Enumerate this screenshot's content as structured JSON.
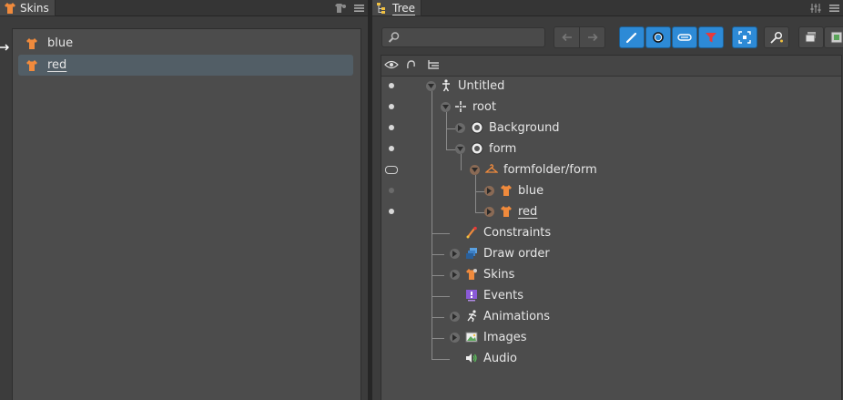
{
  "skins_panel": {
    "tab_label": "Skins",
    "items": [
      {
        "label": "blue",
        "selected": false
      },
      {
        "label": "red",
        "selected": true
      }
    ]
  },
  "tree_panel": {
    "tab_label": "Tree",
    "search": {
      "placeholder": "",
      "value": ""
    },
    "nodes": {
      "untitled": "Untitled",
      "root": "root",
      "background": "Background",
      "form": "form",
      "formfolder": "formfolder/form",
      "blue": "blue",
      "red": "red",
      "constraints": "Constraints",
      "draw_order": "Draw order",
      "skins": "Skins",
      "events": "Events",
      "animations": "Animations",
      "images": "Images",
      "audio": "Audio"
    }
  },
  "colors": {
    "accent_blue": "#2d8ad6",
    "skin_orange": "#f08a3c",
    "selection": "#525e66"
  }
}
